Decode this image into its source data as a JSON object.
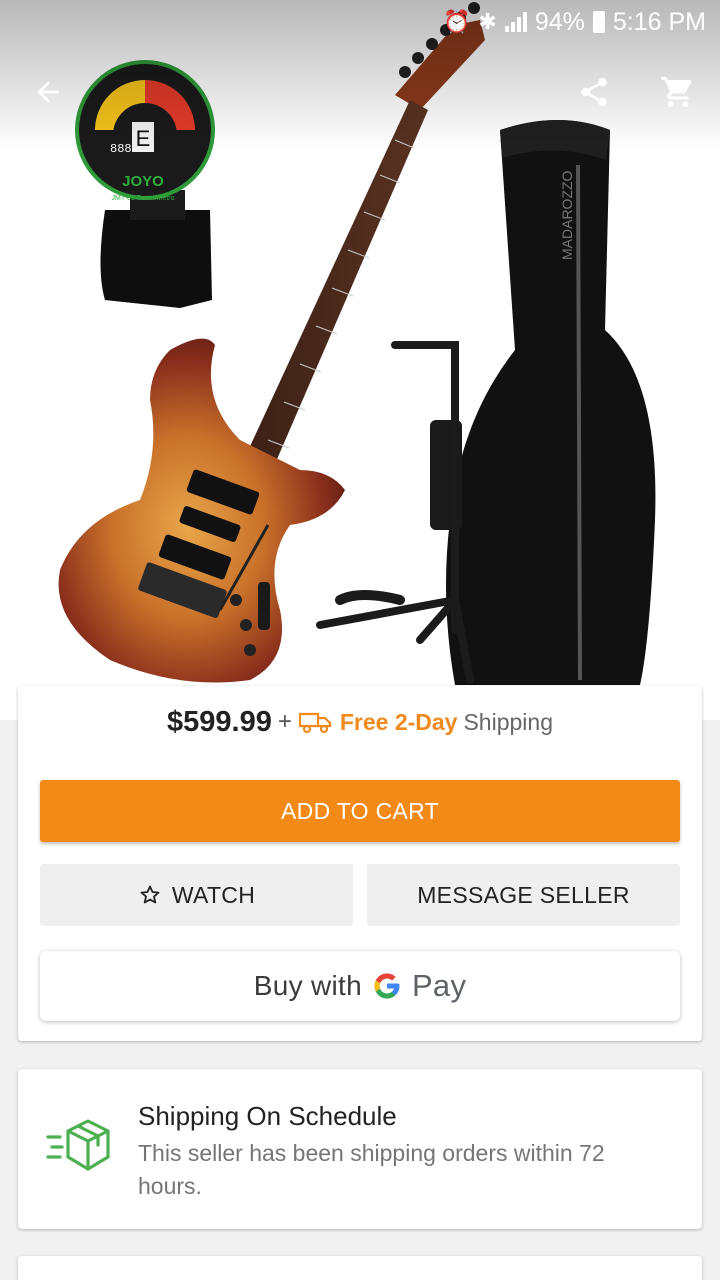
{
  "status_bar": {
    "battery": "94%",
    "time": "5:16 PM"
  },
  "toolbar": {
    "back_icon": "arrow-left-icon",
    "share_icon": "share-icon",
    "cart_icon": "shopping-cart-icon"
  },
  "product": {
    "price": "$599.99",
    "plus": "+",
    "shipping_free": "Free 2-Day",
    "shipping_word": "Shipping"
  },
  "actions": {
    "add_to_cart": "ADD TO CART",
    "watch": "WATCH",
    "message_seller": "MESSAGE SELLER",
    "buy_with": "Buy with",
    "pay": "Pay"
  },
  "shipping_info": {
    "title": "Shipping On Schedule",
    "description": "This seller has been shipping orders within 72 hours."
  },
  "hero_image": {
    "tuner_brand": "JOYO",
    "tuner_model": "JMT-01 Tuner/Metro",
    "tuner_note": "E"
  },
  "colors": {
    "accent": "#f38a17",
    "ship_icon": "#4caf50"
  }
}
